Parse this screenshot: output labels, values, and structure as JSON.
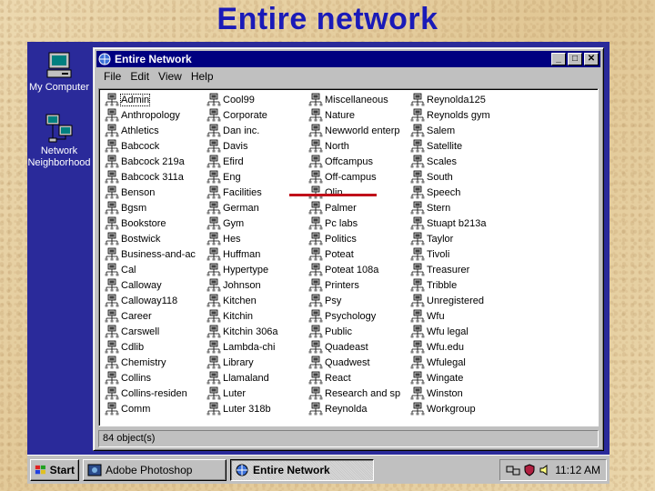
{
  "slide": {
    "title": "Entire network"
  },
  "desktop": {
    "icons": [
      {
        "label": "My Computer"
      },
      {
        "label": "Network Neighborhood"
      }
    ]
  },
  "window": {
    "title": "Entire Network",
    "menu": [
      "File",
      "Edit",
      "View",
      "Help"
    ],
    "buttons": {
      "minimize": "_",
      "maximize": "□",
      "close": "✕"
    },
    "columns": [
      [
        "Admin",
        "Anthropology",
        "Athletics",
        "Babcock",
        "Babcock 219a",
        "Babcock 311a",
        "Benson",
        "Bgsm",
        "Bookstore",
        "Bostwick",
        "Business-and-ac",
        "Cal",
        "Calloway",
        "Calloway118",
        "Career",
        "Carswell",
        "Cdlib",
        "Chemistry",
        "Collins",
        "Collins-residen",
        "Comm"
      ],
      [
        "Cool99",
        "Corporate",
        "Dan inc.",
        "Davis",
        "Efird",
        "Eng",
        "Facilities",
        "German",
        "Gym",
        "Hes",
        "Huffman",
        "Hypertype",
        "Johnson",
        "Kitchen",
        "Kitchin",
        "Kitchin 306a",
        "Lambda-chi",
        "Library",
        "Llamaland",
        "Luter",
        "Luter 318b"
      ],
      [
        "Miscellaneous",
        "Nature",
        "Newworld enterp",
        "North",
        "Offcampus",
        "Off-campus",
        "Olin",
        "Palmer",
        "Pc labs",
        "Politics",
        "Poteat",
        "Poteat 108a",
        "Printers",
        "Psy",
        "Psychology",
        "Public",
        "Quadeast",
        "Quadwest",
        "React",
        "Research and sp",
        "Reynolda"
      ],
      [
        "Reynolda125",
        "Reynolds gym",
        "Salem",
        "Satellite",
        "Scales",
        "South",
        "Speech",
        "Stern",
        "Stuapt b213a",
        "Taylor",
        "Tivoli",
        "Treasurer",
        "Tribble",
        "Unregistered",
        "Wfu",
        "Wfu legal",
        "Wfu.edu",
        "Wfulegal",
        "Wingate",
        "Winston",
        "Workgroup"
      ]
    ],
    "status": "84 object(s)"
  },
  "taskbar": {
    "start_label": "Start",
    "tasks": [
      {
        "label": "Adobe Photoshop",
        "active": false
      },
      {
        "label": "Entire Network",
        "active": true
      }
    ],
    "clock": "11:12 AM"
  },
  "colors": {
    "slide_title": "#1a1ab8",
    "desktop": "#2a2a9a",
    "titlebar": "#000080",
    "annotation": "#c0101a"
  }
}
